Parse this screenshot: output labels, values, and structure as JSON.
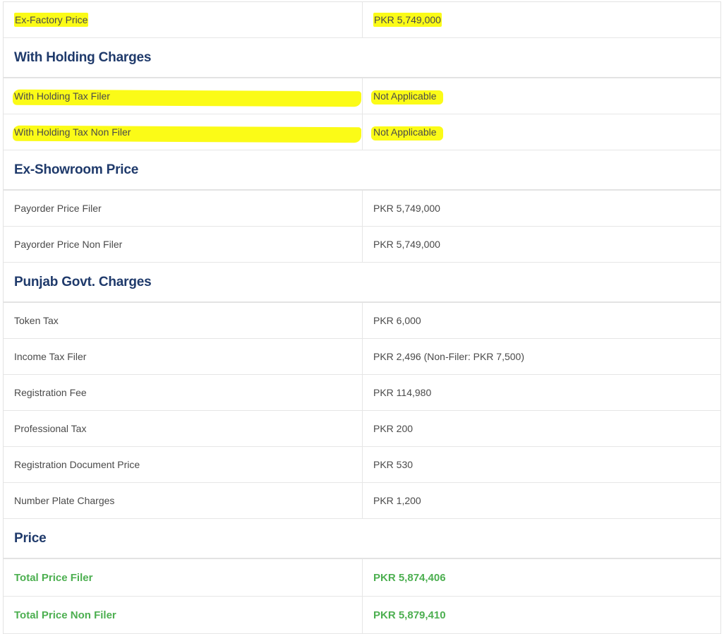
{
  "rows": {
    "ex_factory": {
      "label": "Ex-Factory Price",
      "value": "PKR 5,749,000"
    },
    "with_holding_heading": "With Holding Charges",
    "wht_filer": {
      "label": "With Holding Tax Filer",
      "value": "Not Applicable"
    },
    "wht_non_filer": {
      "label": "With Holding Tax Non Filer",
      "value": "Not Applicable"
    },
    "ex_showroom_heading": "Ex-Showroom Price",
    "payorder_filer": {
      "label": "Payorder Price Filer",
      "value": "PKR 5,749,000"
    },
    "payorder_non_filer": {
      "label": "Payorder Price Non Filer",
      "value": "PKR 5,749,000"
    },
    "punjab_heading": "Punjab Govt. Charges",
    "token_tax": {
      "label": "Token Tax",
      "value": "PKR 6,000"
    },
    "income_tax_filer": {
      "label": "Income Tax Filer",
      "value": "PKR 2,496 (Non-Filer: PKR 7,500)"
    },
    "registration_fee": {
      "label": "Registration Fee",
      "value": "PKR 114,980"
    },
    "professional_tax": {
      "label": "Professional Tax",
      "value": "PKR 200"
    },
    "registration_document": {
      "label": "Registration Document Price",
      "value": "PKR 530"
    },
    "number_plate": {
      "label": "Number Plate Charges",
      "value": "PKR 1,200"
    },
    "price_heading": "Price",
    "total_filer": {
      "label": "Total Price Filer",
      "value": "PKR 5,874,406"
    },
    "total_non_filer": {
      "label": "Total Price Non Filer",
      "value": "PKR 5,879,410"
    }
  },
  "colors": {
    "heading": "#1f3a6b",
    "total": "#4caf50",
    "highlight": "#fbfb17",
    "text": "#4a4a4a",
    "border": "#e6e6e6"
  }
}
